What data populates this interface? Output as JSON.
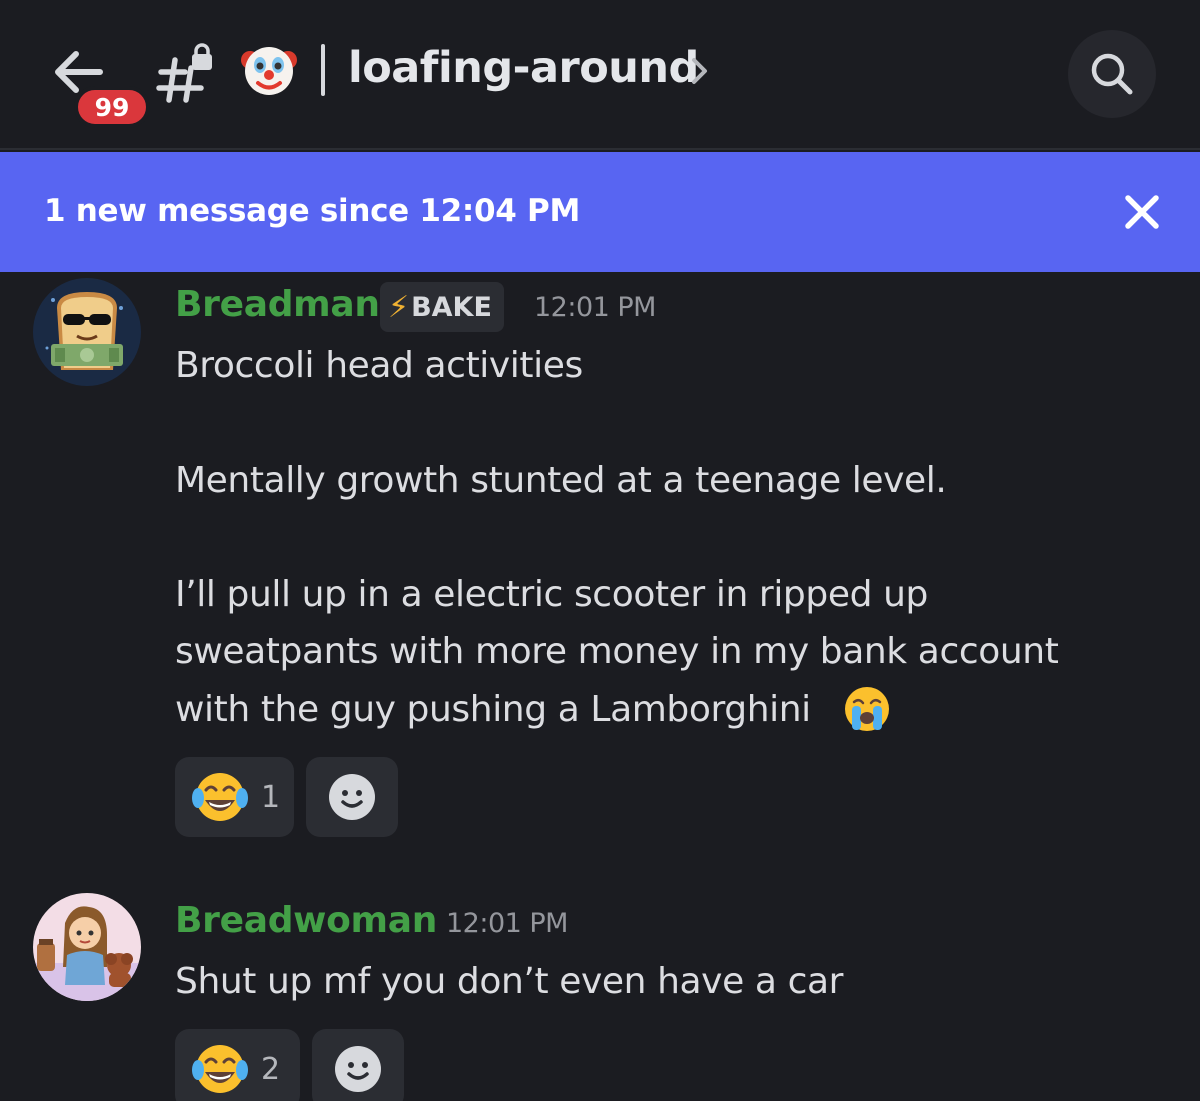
{
  "header": {
    "unread_badge": "99",
    "channel_name": "loafing-around"
  },
  "new_message_bar": {
    "text": "1 new message since 12:04 PM"
  },
  "messages": [
    {
      "username": "Breadman",
      "tag": "BAKE",
      "timestamp": "12:01 PM",
      "lines": [
        "Broccoli head activities",
        "Mentally growth stunted at a teenage level.",
        "I’ll pull up in a electric scooter in ripped up",
        "sweatpants with more money in my bank account",
        "with the guy pushing a Lamborghini"
      ],
      "reaction_count": "1"
    },
    {
      "username": "Breadwoman",
      "timestamp": "12:01 PM",
      "lines": [
        "Shut up mf you don’t even have a car"
      ],
      "reaction_count": "2"
    }
  ],
  "colors": {
    "background": "#1b1c21",
    "accent_bar": "#5865f2",
    "username": "#43a047",
    "badge": "#da373c"
  },
  "icons": [
    "back-arrow-icon",
    "locked-hash-icon",
    "clown-emoji",
    "chevron-right-icon",
    "search-icon",
    "close-icon",
    "crying-emoji",
    "tears-of-joy-emoji",
    "add-reaction-icon"
  ]
}
